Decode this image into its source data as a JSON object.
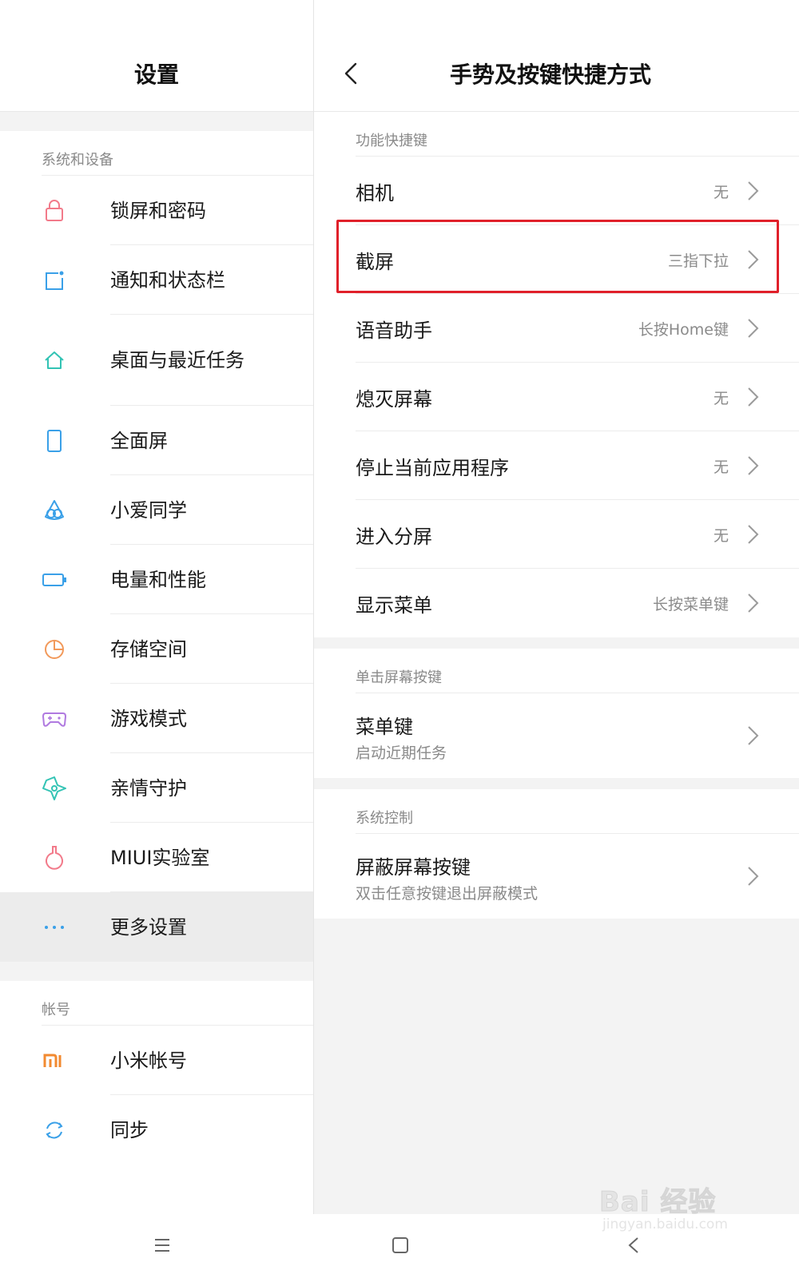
{
  "left_panel": {
    "title": "设置",
    "section_system": "系统和设备",
    "items": [
      {
        "label": "锁屏和密码",
        "icon": "lock-icon",
        "color": "#f27a8a"
      },
      {
        "label": "通知和状态栏",
        "icon": "notification-icon",
        "color": "#3aa0e8"
      },
      {
        "label": "桌面与最近任务",
        "icon": "home-icon",
        "color": "#32c3b4"
      },
      {
        "label": "全面屏",
        "icon": "phone-icon",
        "color": "#3aa0e8"
      },
      {
        "label": "小爱同学",
        "icon": "xiaoai-icon",
        "color": "#3aa0e8"
      },
      {
        "label": "电量和性能",
        "icon": "battery-icon",
        "color": "#3aa0e8"
      },
      {
        "label": "存储空间",
        "icon": "storage-pie-icon",
        "color": "#f2995a"
      },
      {
        "label": "游戏模式",
        "icon": "gamepad-icon",
        "color": "#b07ae0"
      },
      {
        "label": "亲情守护",
        "icon": "family-guard-icon",
        "color": "#32c3b4"
      },
      {
        "label": "MIUI实验室",
        "icon": "flask-icon",
        "color": "#f27a8a"
      },
      {
        "label": "更多设置",
        "icon": "more-dots-icon",
        "color": "#3aa0e8"
      }
    ],
    "section_account": "帐号",
    "account_items": [
      {
        "label": "小米帐号",
        "icon": "mi-logo-icon",
        "color": "#f28a30"
      },
      {
        "label": "同步",
        "icon": "sync-icon",
        "color": "#3aa0e8"
      }
    ]
  },
  "right_panel": {
    "title": "手势及按键快捷方式",
    "section_shortcuts": "功能快捷键",
    "shortcut_items": [
      {
        "label": "相机",
        "value": "无"
      },
      {
        "label": "截屏",
        "value": "三指下拉"
      },
      {
        "label": "语音助手",
        "value": "长按Home键"
      },
      {
        "label": "熄灭屏幕",
        "value": "无"
      },
      {
        "label": "停止当前应用程序",
        "value": "无"
      },
      {
        "label": "进入分屏",
        "value": "无"
      },
      {
        "label": "显示菜单",
        "value": "长按菜单键"
      }
    ],
    "section_single_press": "单击屏幕按键",
    "menu_key": {
      "label": "菜单键",
      "sub": "启动近期任务"
    },
    "section_system_control": "系统控制",
    "block_keys": {
      "label": "屏蔽屏幕按键",
      "sub": "双击任意按键退出屏蔽模式"
    }
  },
  "watermark": {
    "brand": "Bai 经验",
    "url": "jingyan.baidu.com"
  },
  "colors": {
    "highlight": "#e0202a",
    "accent": "#3aa0e8"
  }
}
